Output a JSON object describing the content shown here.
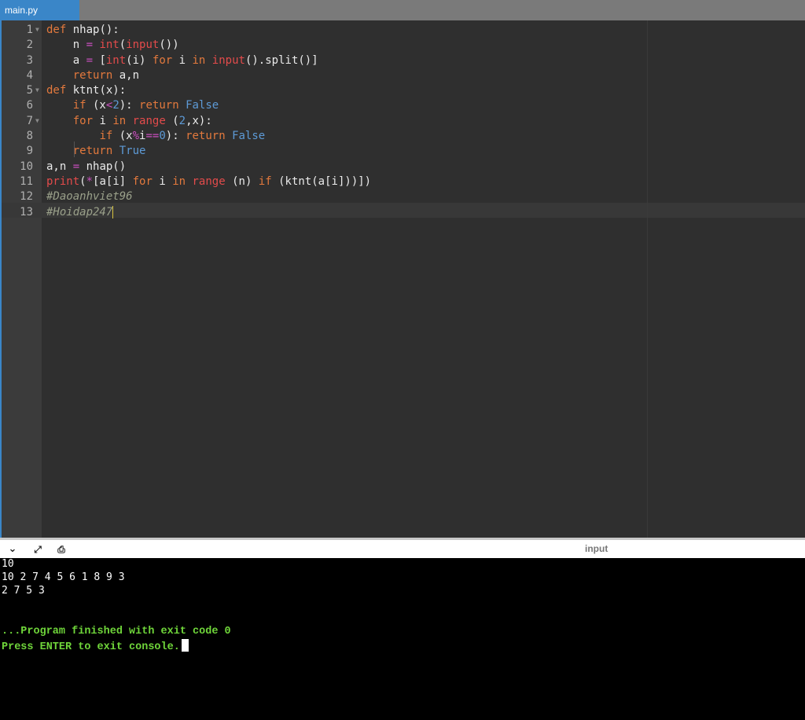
{
  "tab": {
    "label": "main.py"
  },
  "editor": {
    "line_numbers": [
      "1",
      "2",
      "3",
      "4",
      "5",
      "6",
      "7",
      "8",
      "9",
      "10",
      "11",
      "12",
      "13"
    ],
    "lines": [
      [
        [
          "kw",
          "def"
        ],
        [
          "t",
          " nhap():"
        ]
      ],
      [
        [
          "t",
          "    n "
        ],
        [
          "op",
          "="
        ],
        [
          "t",
          " "
        ],
        [
          "bi",
          "int"
        ],
        [
          "t",
          "("
        ],
        [
          "bi",
          "input"
        ],
        [
          "t",
          "())"
        ]
      ],
      [
        [
          "t",
          "    a "
        ],
        [
          "op",
          "="
        ],
        [
          "t",
          " ["
        ],
        [
          "bi",
          "int"
        ],
        [
          "t",
          "(i) "
        ],
        [
          "kw",
          "for"
        ],
        [
          "t",
          " i "
        ],
        [
          "kw",
          "in"
        ],
        [
          "t",
          " "
        ],
        [
          "bi",
          "input"
        ],
        [
          "t",
          "().split()]"
        ]
      ],
      [
        [
          "t",
          "    "
        ],
        [
          "kw",
          "return"
        ],
        [
          "t",
          " a,n"
        ]
      ],
      [
        [
          "kw",
          "def"
        ],
        [
          "t",
          " ktnt(x):"
        ]
      ],
      [
        [
          "t",
          "    "
        ],
        [
          "kw",
          "if"
        ],
        [
          "t",
          " (x"
        ],
        [
          "op",
          "<"
        ],
        [
          "num",
          "2"
        ],
        [
          "t",
          "): "
        ],
        [
          "kw",
          "return"
        ],
        [
          "t",
          " "
        ],
        [
          "kb",
          "False"
        ]
      ],
      [
        [
          "t",
          "    "
        ],
        [
          "kw",
          "for"
        ],
        [
          "t",
          " i "
        ],
        [
          "kw",
          "in"
        ],
        [
          "t",
          " "
        ],
        [
          "bi",
          "range"
        ],
        [
          "t",
          " ("
        ],
        [
          "num",
          "2"
        ],
        [
          "t",
          ",x):"
        ]
      ],
      [
        [
          "t",
          "        "
        ],
        [
          "kw",
          "if"
        ],
        [
          "t",
          " (x"
        ],
        [
          "op",
          "%"
        ],
        [
          "t",
          "i"
        ],
        [
          "op",
          "=="
        ],
        [
          "num",
          "0"
        ],
        [
          "t",
          "): "
        ],
        [
          "kw",
          "return"
        ],
        [
          "t",
          " "
        ],
        [
          "kb",
          "False"
        ]
      ],
      [
        [
          "t",
          "    "
        ],
        [
          "kw",
          "return"
        ],
        [
          "t",
          " "
        ],
        [
          "kb",
          "True"
        ]
      ],
      [
        [
          "t",
          "a,n "
        ],
        [
          "op",
          "="
        ],
        [
          "t",
          " nhap()"
        ]
      ],
      [
        [
          "bi",
          "print"
        ],
        [
          "t",
          "("
        ],
        [
          "op",
          "*"
        ],
        [
          "t",
          "[a[i] "
        ],
        [
          "kw",
          "for"
        ],
        [
          "t",
          " i "
        ],
        [
          "kw",
          "in"
        ],
        [
          "t",
          " "
        ],
        [
          "bi",
          "range"
        ],
        [
          "t",
          " (n) "
        ],
        [
          "kw",
          "if"
        ],
        [
          "t",
          " (ktnt(a[i]))])"
        ]
      ],
      [
        [
          "cm",
          "#Daoanhviet96"
        ]
      ],
      [
        [
          "cm",
          "#Hoidap247"
        ]
      ]
    ],
    "fold_lines": [
      1,
      5,
      7
    ]
  },
  "console_toolbar": {
    "input_label": "input"
  },
  "console": {
    "output_lines": [
      "10",
      "10 2 7 4 5 6 1 8 9 3",
      "2 7 5 3"
    ],
    "finished": "...Program finished with exit code 0",
    "press_enter": "Press ENTER to exit console."
  }
}
